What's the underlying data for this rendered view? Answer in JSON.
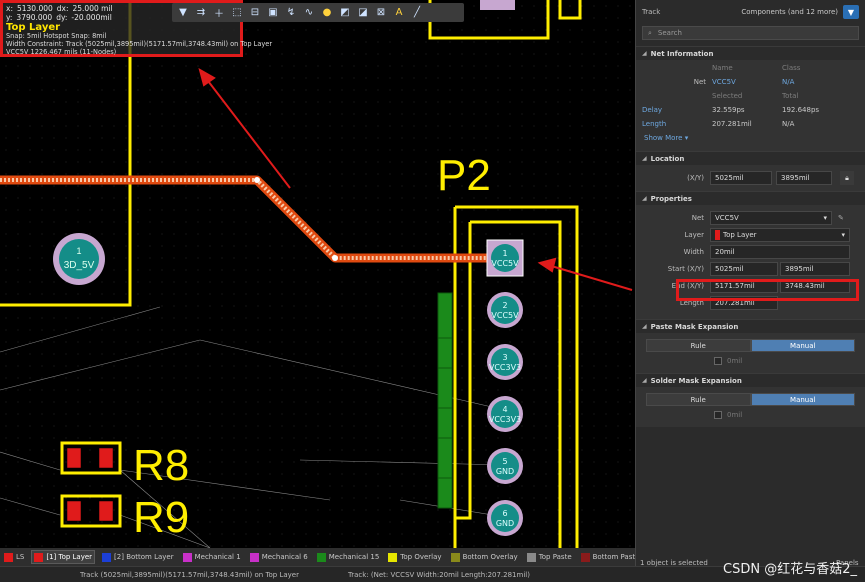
{
  "hud": {
    "x_label": "x:",
    "x_value": "5130.000",
    "dx_label": "dx:",
    "dx_value": "25.000 mil",
    "y_label": "y:",
    "y_value": "3790.000",
    "dy_label": "dy:",
    "dy_value": "-20.000mil",
    "layer": "Top Layer",
    "snap": "Snap: 5mil Hotspot Snap: 8mil",
    "width_constraint": "Width Constraint: Track (5025mil,3895mil)(5171.57mil,3748.43mil) on Top Layer",
    "net_info": "VCC5V   1226.467 mils (11-Nodes)"
  },
  "toolbar": {
    "icons": [
      "filter-icon",
      "route-icon",
      "plus-icon",
      "select-rect-icon",
      "align-icon",
      "component-icon",
      "interactive-route-icon",
      "diff-pair-icon",
      "pin-icon",
      "polygon-icon",
      "region-icon",
      "dimension-icon",
      "string-icon",
      "line-icon"
    ]
  },
  "pcb": {
    "designator_p2": "P2",
    "designator_r8": "R8",
    "designator_r9": "R9",
    "pad_3d5v_num": "1",
    "pad_3d5v_net": "3D_5V",
    "p2_pads": [
      {
        "num": "1",
        "net": "VCC5V"
      },
      {
        "num": "2",
        "net": "VCC5V"
      },
      {
        "num": "3",
        "net": "VCC3V3"
      },
      {
        "num": "4",
        "net": "VCC3V3"
      },
      {
        "num": "5",
        "net": "GND"
      },
      {
        "num": "6",
        "net": "GND"
      }
    ]
  },
  "panel": {
    "title": "Track",
    "scope": "Components (and 12 more)",
    "search_placeholder": "Search",
    "net_info": {
      "heading": "Net Information",
      "col_name": "Name",
      "col_class": "Class",
      "row_net_label": "Net",
      "row_net_name": "VCC5V",
      "row_net_class": "N/A",
      "col_selected": "Selected",
      "col_total": "Total",
      "delay_label": "Delay",
      "delay_selected": "32.559ps",
      "delay_total": "192.648ps",
      "length_label": "Length",
      "length_selected": "207.281mil",
      "length_total": "N/A",
      "show_more": "Show More ▾"
    },
    "location": {
      "heading": "Location",
      "xy_label": "(X/Y)",
      "x": "5025mil",
      "y": "3895mil"
    },
    "properties": {
      "heading": "Properties",
      "net_label": "Net",
      "net_value": "VCC5V",
      "layer_label": "Layer",
      "layer_value": "Top Layer",
      "layer_color": "#e01b1b",
      "width_label": "Width",
      "width_value": "20mil",
      "start_label": "Start (X/Y)",
      "start_x": "5025mil",
      "start_y": "3895mil",
      "end_label": "End (X/Y)",
      "end_x": "5171.57mil",
      "end_y": "3748.43mil",
      "length_label": "Length",
      "length_value": "207.281mil"
    },
    "paste_mask": {
      "heading": "Paste Mask Expansion",
      "rule": "Rule",
      "manual": "Manual",
      "value": "0mil"
    },
    "solder_mask": {
      "heading": "Solder Mask Expansion",
      "rule": "Rule",
      "manual": "Manual",
      "value": "0mil"
    }
  },
  "tabs": [
    {
      "label": "LS",
      "color": "#e01b1b"
    },
    {
      "label": "[1] Top Layer",
      "color": "#e01b1b",
      "active": true
    },
    {
      "label": "[2] Bottom Layer",
      "color": "#1c3fd6"
    },
    {
      "label": "Mechanical 1",
      "color": "#c830c8"
    },
    {
      "label": "Mechanical 6",
      "color": "#c830c8"
    },
    {
      "label": "Mechanical 15",
      "color": "#1b8a1b"
    },
    {
      "label": "Top Overlay",
      "color": "#e6e600"
    },
    {
      "label": "Bottom Overlay",
      "color": "#8a8a1b"
    },
    {
      "label": "Top Paste",
      "color": "#8a8a8a"
    },
    {
      "label": "Bottom Paste",
      "color": "#8a1b1b"
    }
  ],
  "status": {
    "left": "Track (5025mil,3895mil)(5171.57mil,3748.43mil) on Top Layer",
    "mid": "Track: (Net: VCCSV Width:20mil Length:207.281mil)",
    "right": "1 object is selected",
    "panels": "Panels"
  },
  "watermark": "CSDN @红花与香菇2_"
}
